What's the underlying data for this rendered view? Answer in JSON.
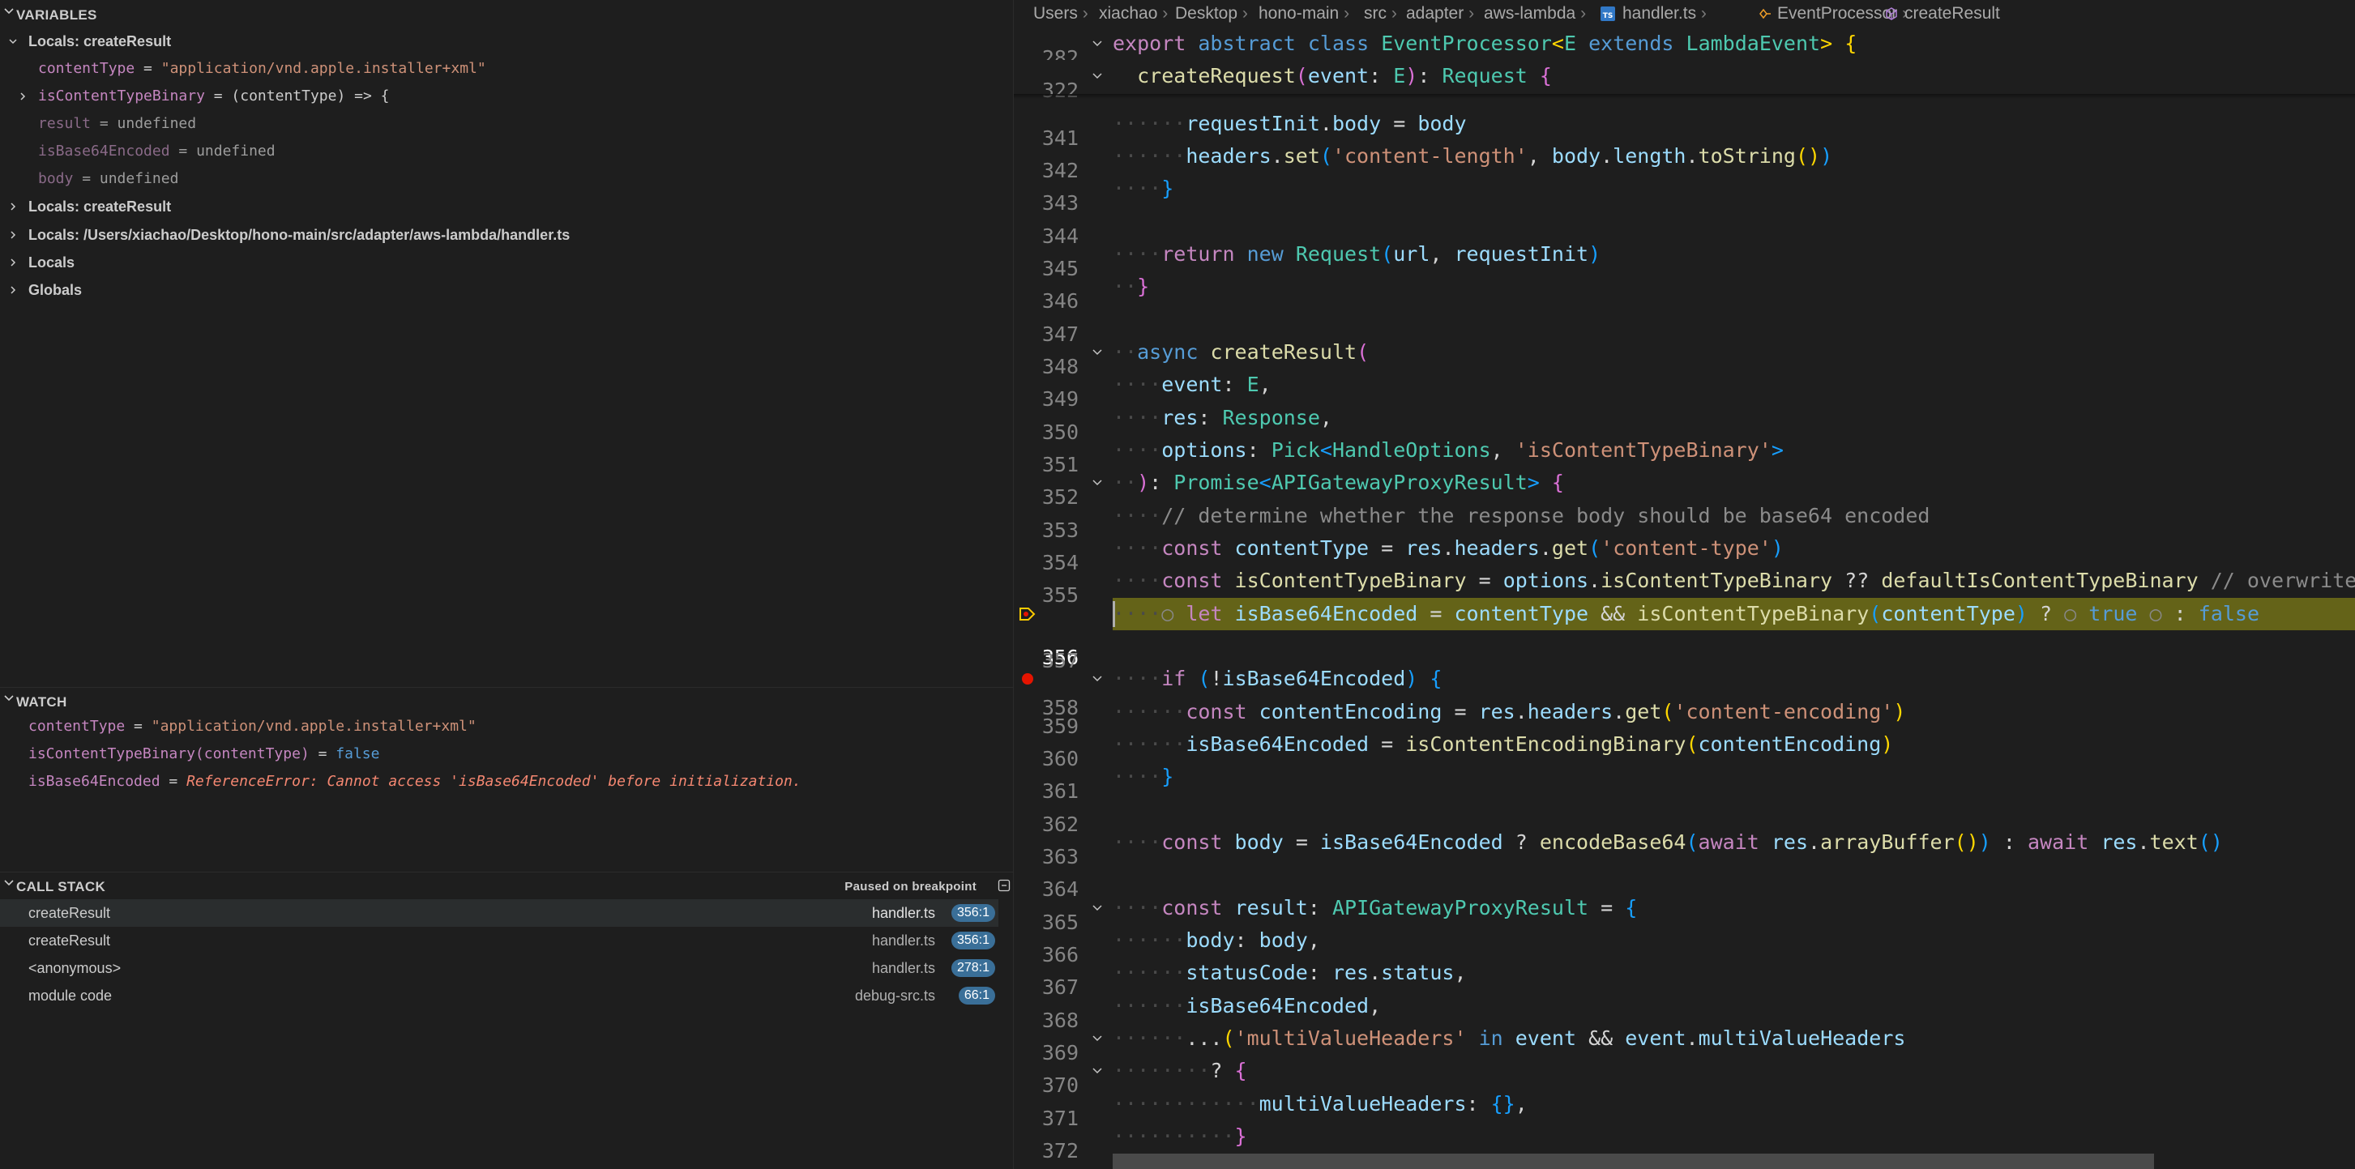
{
  "variables": {
    "header": "VARIABLES",
    "scopes": [
      {
        "label": "Locals: createResult",
        "expanded": true,
        "items": [
          {
            "name": "contentType",
            "value": "\"application/vnd.apple.installer+xml\"",
            "kind": "string"
          },
          {
            "name": "isContentTypeBinary",
            "value": "(contentType) => {",
            "kind": "function",
            "expandable": true
          },
          {
            "name": "result",
            "value": "undefined",
            "kind": "undefined"
          },
          {
            "name": "isBase64Encoded",
            "value": "undefined",
            "kind": "undefined"
          },
          {
            "name": "body",
            "value": "undefined",
            "kind": "undefined"
          }
        ]
      },
      {
        "label": "Locals: createResult",
        "expanded": false
      },
      {
        "label": "Locals: /Users/xiachao/Desktop/hono-main/src/adapter/aws-lambda/handler.ts",
        "expanded": false
      },
      {
        "label": "Locals",
        "expanded": false
      },
      {
        "label": "Globals",
        "expanded": false
      }
    ]
  },
  "watch": {
    "header": "WATCH",
    "items": [
      {
        "name": "contentType",
        "value": "\"application/vnd.apple.installer+xml\"",
        "kind": "string"
      },
      {
        "name": "isContentTypeBinary(contentType)",
        "value": "false",
        "kind": "boolean"
      },
      {
        "name": "isBase64Encoded",
        "value": "ReferenceError: Cannot access 'isBase64Encoded' before initialization.",
        "kind": "error"
      }
    ]
  },
  "call_stack": {
    "header": "CALL STACK",
    "status": "Paused on breakpoint",
    "frames": [
      {
        "fn": "createResult",
        "file": "handler.ts",
        "loc": "356:1",
        "selected": true
      },
      {
        "fn": "createResult",
        "file": "handler.ts",
        "loc": "356:1"
      },
      {
        "fn": "<anonymous>",
        "file": "handler.ts",
        "loc": "278:1"
      },
      {
        "fn": "module code",
        "file": "debug-src.ts",
        "loc": "66:1"
      }
    ]
  },
  "editor": {
    "breadcrumb": [
      "Users",
      "xiachao",
      "Desktop",
      "hono-main",
      "src",
      "adapter",
      "aws-lambda",
      "handler.ts",
      "EventProcessor",
      "createResult"
    ],
    "current_line": "356",
    "breakpoint_line": "358",
    "sticky": [
      {
        "ln": "282",
        "text": "export abstract class EventProcessor<E extends LambdaEvent> {"
      },
      {
        "ln": "322",
        "text": "  createRequest(event: E): Request {"
      }
    ],
    "lines": [
      {
        "ln": "341",
        "text": "      requestInit.body = body"
      },
      {
        "ln": "342",
        "text": "      headers.set('content-length', body.length.toString())"
      },
      {
        "ln": "343",
        "text": "    }"
      },
      {
        "ln": "344",
        "text": ""
      },
      {
        "ln": "345",
        "text": "    return new Request(url, requestInit)"
      },
      {
        "ln": "346",
        "text": "  }"
      },
      {
        "ln": "347",
        "text": ""
      },
      {
        "ln": "348",
        "text": "  async createResult("
      },
      {
        "ln": "349",
        "text": "    event: E,"
      },
      {
        "ln": "350",
        "text": "    res: Response,"
      },
      {
        "ln": "351",
        "text": "    options: Pick<HandleOptions, 'isContentTypeBinary'>"
      },
      {
        "ln": "352",
        "text": "  ): Promise<APIGatewayProxyResult> {"
      },
      {
        "ln": "353",
        "text": "    // determine whether the response body should be base64 encoded"
      },
      {
        "ln": "354",
        "text": "    const contentType = res.headers.get('content-type')"
      },
      {
        "ln": "355",
        "text": "    const isContentTypeBinary = options.isContentTypeBinary ?? defaultIsContentTypeBinary // overwrite default"
      },
      {
        "ln": "356",
        "text": "    let isBase64Encoded = contentType && isContentTypeBinary(contentType) ? true : false"
      },
      {
        "ln": "357",
        "text": ""
      },
      {
        "ln": "358",
        "text": "    if (!isBase64Encoded) {"
      },
      {
        "ln": "359",
        "text": "      const contentEncoding = res.headers.get('content-encoding')"
      },
      {
        "ln": "360",
        "text": "      isBase64Encoded = isContentEncodingBinary(contentEncoding)"
      },
      {
        "ln": "361",
        "text": "    }"
      },
      {
        "ln": "362",
        "text": ""
      },
      {
        "ln": "363",
        "text": "    const body = isBase64Encoded ? encodeBase64(await res.arrayBuffer()) : await res.text()"
      },
      {
        "ln": "364",
        "text": ""
      },
      {
        "ln": "365",
        "text": "    const result: APIGatewayProxyResult = {"
      },
      {
        "ln": "366",
        "text": "      body: body,"
      },
      {
        "ln": "367",
        "text": "      statusCode: res.status,"
      },
      {
        "ln": "368",
        "text": "      isBase64Encoded,"
      },
      {
        "ln": "369",
        "text": "      ...('multiValueHeaders' in event && event.multiValueHeaders"
      },
      {
        "ln": "370",
        "text": "        ? {"
      },
      {
        "ln": "371",
        "text": "            multiValueHeaders: {},"
      },
      {
        "ln": "372",
        "text": "          }"
      }
    ]
  }
}
